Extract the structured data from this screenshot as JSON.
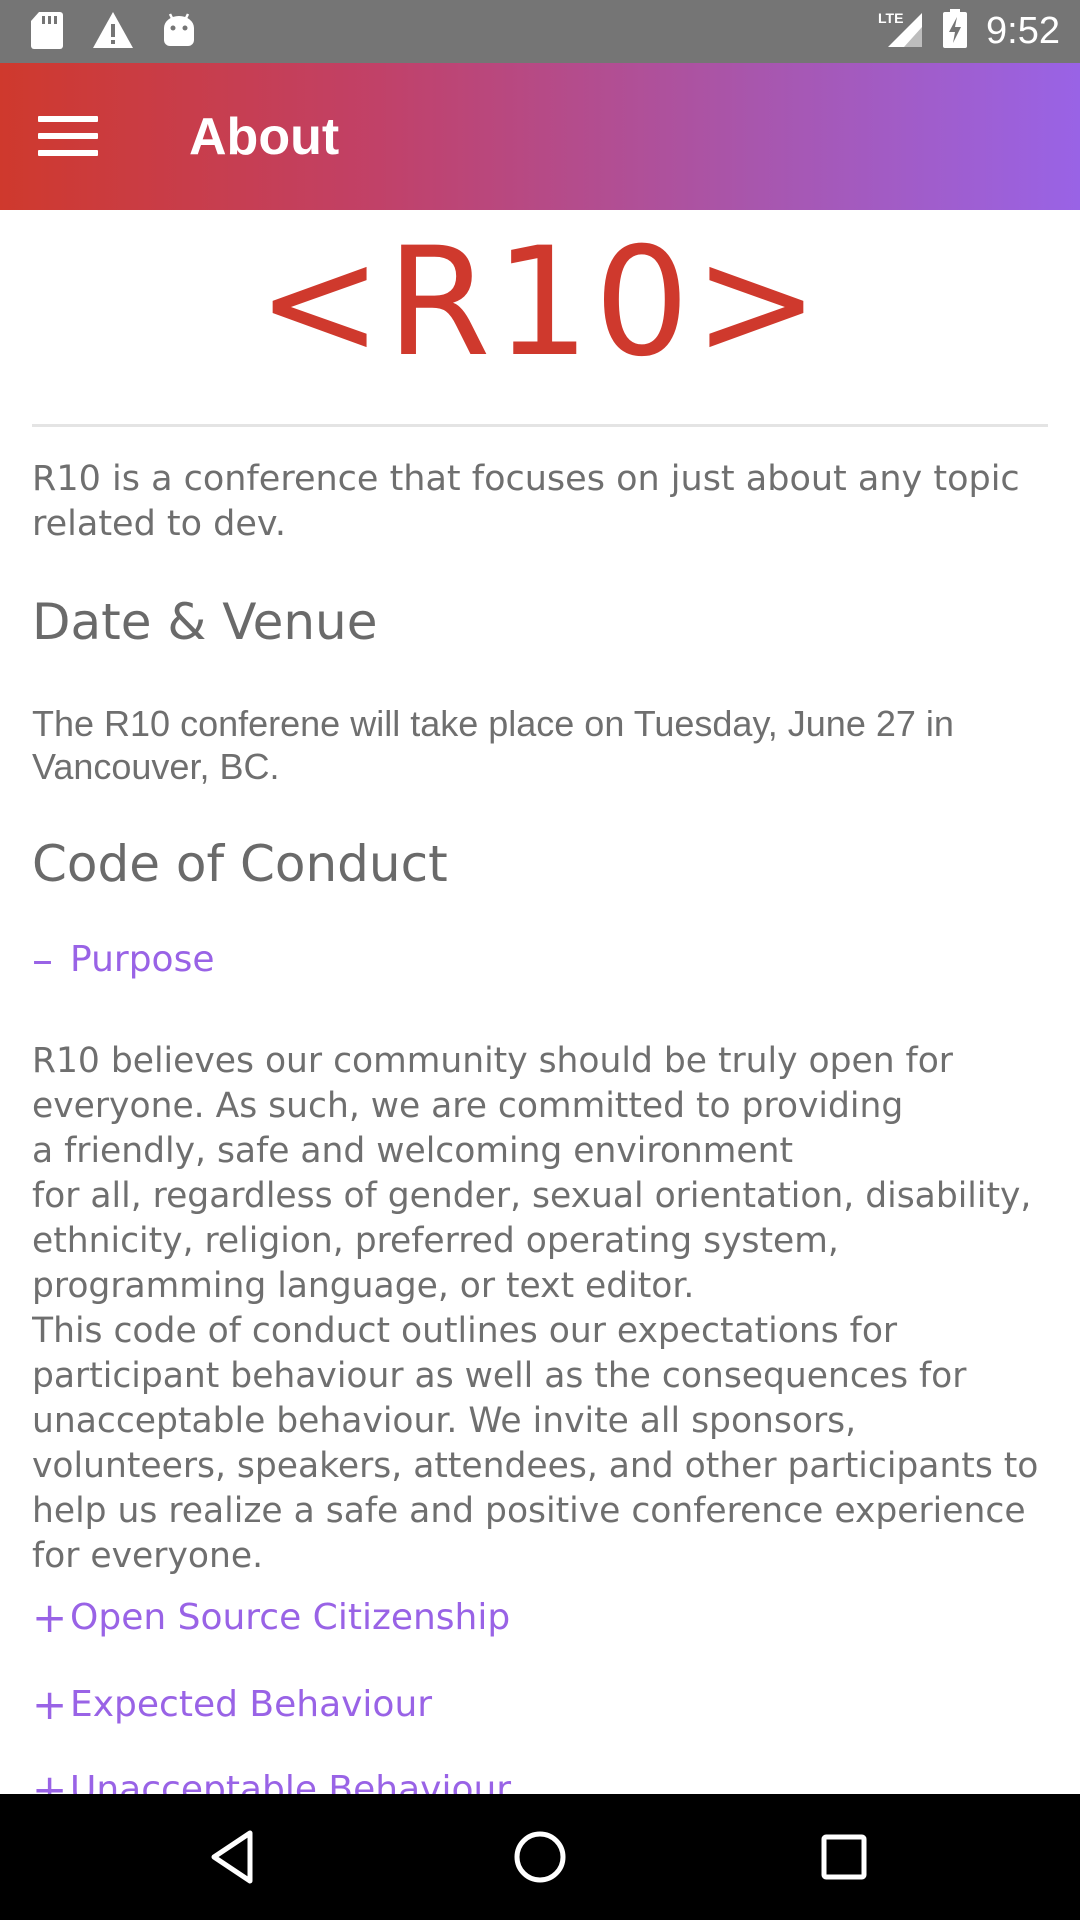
{
  "status_bar": {
    "time": "9:52",
    "network": "LTE",
    "icons": [
      "sd-card-icon",
      "alert-icon",
      "android-icon",
      "signal-icon",
      "battery-charging-icon"
    ]
  },
  "app_bar": {
    "title": "About",
    "menu_icon": "menu-icon"
  },
  "logo": {
    "text": "<R10>",
    "color": "#cf392d"
  },
  "intro": "R10 is a conference that focuses on just about any topic related to dev.",
  "date_venue": {
    "heading": "Date & Venue",
    "body": "The R10 conferene will take place on Tuesday, June 27 in Vancouver, BC."
  },
  "code_of_conduct": {
    "heading": "Code of Conduct",
    "sections": [
      {
        "sign": "–",
        "title": "Purpose",
        "expanded": true,
        "body": "R10 believes our community should be truly open for everyone. As such, we are committed to providing\na friendly, safe and welcoming environment\nfor all, regardless of gender, sexual orientation, disability, ethnicity, religion, preferred operating system, programming language, or text editor.\nThis code of conduct outlines our expectations for participant behaviour as well as the consequences for unacceptable behaviour. We invite all sponsors, volunteers, speakers, attendees, and other participants to help us realize a safe and positive conference experience for everyone."
      },
      {
        "sign": "+",
        "title": "Open Source Citizenship",
        "expanded": false
      },
      {
        "sign": "+",
        "title": "Expected Behaviour",
        "expanded": false
      },
      {
        "sign": "+",
        "title": "Unacceptable Behaviour",
        "expanded": false
      }
    ]
  },
  "nav_bar": {
    "icons": [
      "back-icon",
      "home-icon",
      "recents-icon"
    ]
  },
  "colors": {
    "accent": "#9963e6",
    "brand_red": "#cf392d",
    "text": "#6f6f6f"
  }
}
